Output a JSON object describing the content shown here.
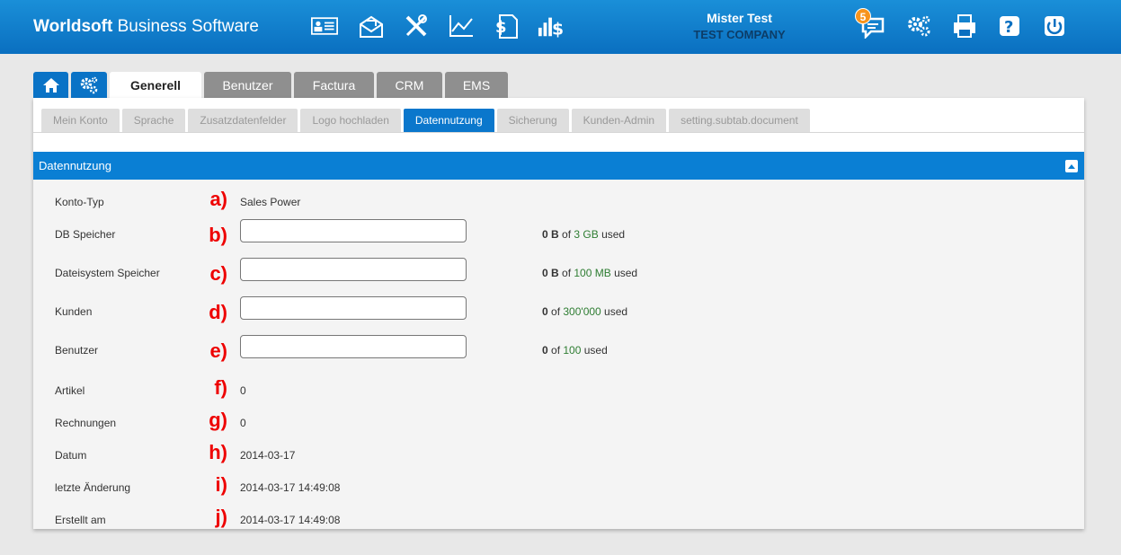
{
  "header": {
    "brand_bold": "Worldsoft",
    "brand_rest": " Business Software",
    "user_name": "Mister Test",
    "company": "TEST COMPANY",
    "notification_count": "5",
    "accent": "#0a7fd4"
  },
  "main_tabs": [
    {
      "label": "Generell",
      "active": true
    },
    {
      "label": "Benutzer"
    },
    {
      "label": "Factura"
    },
    {
      "label": "CRM"
    },
    {
      "label": "EMS"
    }
  ],
  "sub_tabs": [
    {
      "label": "Mein Konto"
    },
    {
      "label": "Sprache"
    },
    {
      "label": "Zusatzdatenfelder"
    },
    {
      "label": "Logo hochladen"
    },
    {
      "label": "Datennutzung",
      "active": true
    },
    {
      "label": "Sicherung"
    },
    {
      "label": "Kunden-Admin"
    },
    {
      "label": "setting.subtab.document"
    }
  ],
  "section_title": "Datennutzung",
  "rows": [
    {
      "label": "Konto-Typ",
      "marker": "a)",
      "value": "Sales Power"
    },
    {
      "label": "DB Speicher",
      "marker": "b)",
      "input_value": "",
      "used": "0 B",
      "of": " of ",
      "limit": "3 GB",
      "suffix": " used"
    },
    {
      "label": "Dateisystem Speicher",
      "marker": "c)",
      "input_value": "",
      "used": "0 B",
      "of": " of ",
      "limit": "100 MB",
      "suffix": " used"
    },
    {
      "label": "Kunden",
      "marker": "d)",
      "input_value": "",
      "used": "0",
      "of": " of ",
      "limit": "300'000",
      "suffix": " used"
    },
    {
      "label": "Benutzer",
      "marker": "e)",
      "input_value": "",
      "used": "0",
      "of": " of ",
      "limit": "100",
      "suffix": " used"
    },
    {
      "label": "Artikel",
      "marker": "f)",
      "value": "0"
    },
    {
      "label": "Rechnungen",
      "marker": "g)",
      "value": "0"
    },
    {
      "label": "Datum",
      "marker": "h)",
      "value": "2014-03-17"
    },
    {
      "label": "letzte Änderung",
      "marker": "i)",
      "value": "2014-03-17 14:49:08"
    },
    {
      "label": "Erstellt am",
      "marker": "j)",
      "value": "2014-03-17 14:49:08"
    }
  ]
}
